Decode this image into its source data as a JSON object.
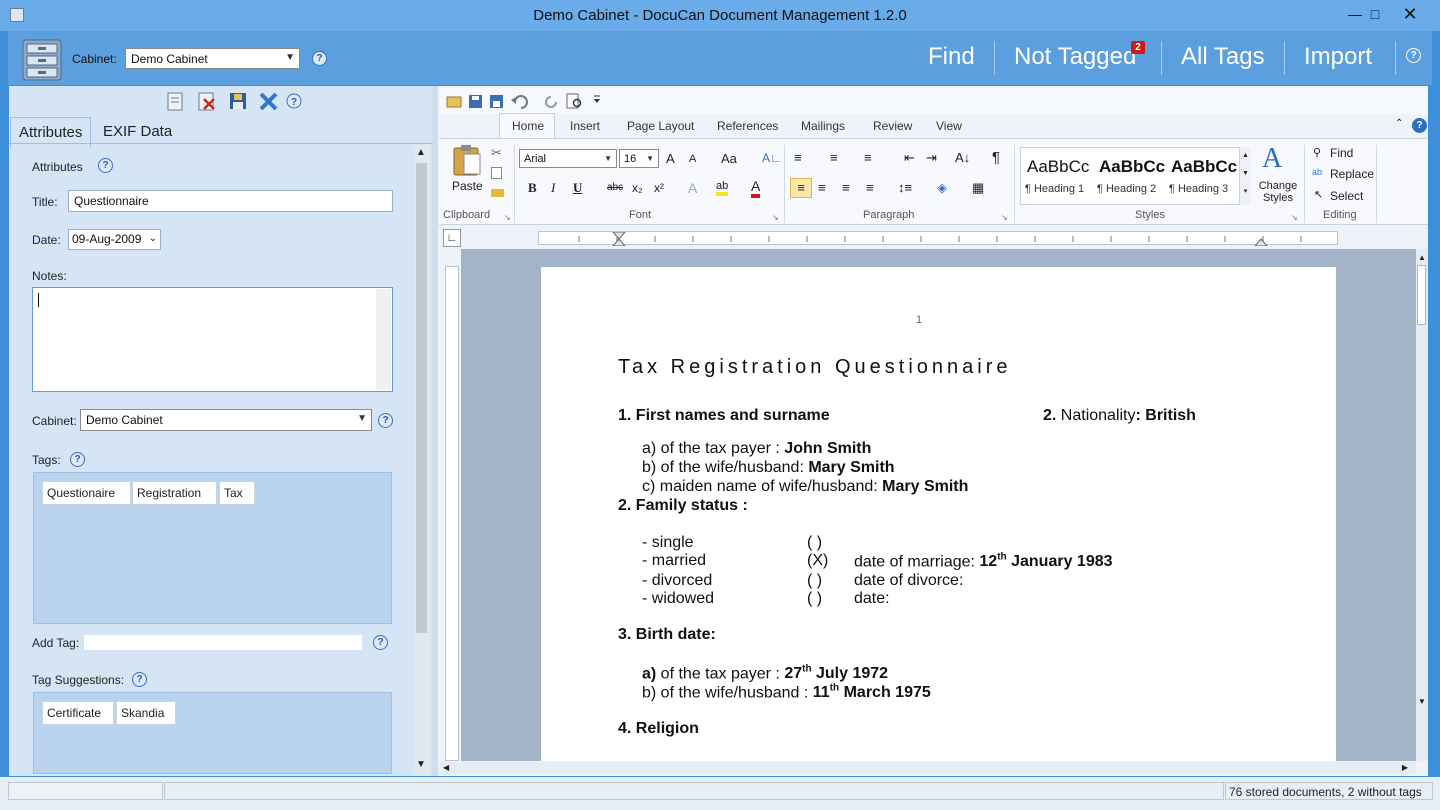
{
  "window": {
    "title": "Demo Cabinet - DocuCan Document Management 1.2.0"
  },
  "header": {
    "cabinet_label": "Cabinet:",
    "cabinet_value": "Demo Cabinet",
    "nav": [
      "Find",
      "Not Tagged",
      "All Tags",
      "Import"
    ],
    "not_tagged_badge": "2"
  },
  "left": {
    "tabs": [
      "Attributes",
      "EXIF Data"
    ],
    "section_title": "Attributes",
    "title_label": "Title:",
    "title_value": "Questionnaire",
    "date_label": "Date:",
    "date_value": "09-Aug-2009",
    "notes_label": "Notes:",
    "cabinet_label": "Cabinet:",
    "cabinet_value": "Demo Cabinet",
    "tags_label": "Tags:",
    "tags": [
      "Questionaire",
      "Registration",
      "Tax"
    ],
    "add_tag_label": "Add Tag:",
    "suggestions_label": "Tag Suggestions:",
    "suggestions": [
      "Certificate",
      "Skandia"
    ]
  },
  "ribbon": {
    "tabs": [
      "Home",
      "Insert",
      "Page Layout",
      "References",
      "Mailings",
      "Review",
      "View"
    ],
    "active_tab": "Home",
    "paste": "Paste",
    "font_name": "Arial",
    "font_size": "16",
    "styles": [
      {
        "sample": "AaBbCc",
        "label": "¶ Heading 1"
      },
      {
        "sample": "AaBbCc",
        "label": "¶ Heading 2"
      },
      {
        "sample": "AaBbCc",
        "label": "¶ Heading 3"
      }
    ],
    "change_styles": "Change Styles",
    "editing": {
      "find": "Find",
      "replace": "Replace",
      "select": "Select"
    },
    "groups": [
      "Clipboard",
      "Font",
      "Paragraph",
      "Styles",
      "Editing"
    ]
  },
  "document": {
    "page_number": "1",
    "title": "Tax Registration Questionnaire",
    "q1": "1. First names and surname",
    "q2_label": "2.",
    "q2_text": "Nationality",
    "q2_value": ": British",
    "a_label": "a)  of the tax payer : ",
    "a_value": "John Smith",
    "b_label": "b)  of the wife/husband: ",
    "b_value": "Mary Smith",
    "c_label": "c)  maiden name of wife/husband: ",
    "c_value": "Mary Smith",
    "family_status": "2. Family status :",
    "single": "- single",
    "married": "- married",
    "divorced": "- divorced",
    "widowed": "- widowed",
    "check_empty": "(  )",
    "check_x": "(X)",
    "marriage_label": "date of marriage: ",
    "marriage_day": "12",
    "marriage_sup": "th",
    "marriage_rest": " January 1983",
    "divorce_label": "date of divorce:",
    "widow_label": "date:",
    "birth": "3. Birth date:",
    "ba_label": "a)",
    "ba_text": "  of the tax payer : ",
    "ba_day": "27",
    "ba_sup": "th",
    "ba_rest": " July 1972",
    "bb_label": "b)  of the wife/husband : ",
    "bb_day": "11",
    "bb_sup": "th",
    "bb_rest": " March 1975",
    "religion": "4.  Religion"
  },
  "status": {
    "text": "76 stored documents, 2 without tags"
  }
}
